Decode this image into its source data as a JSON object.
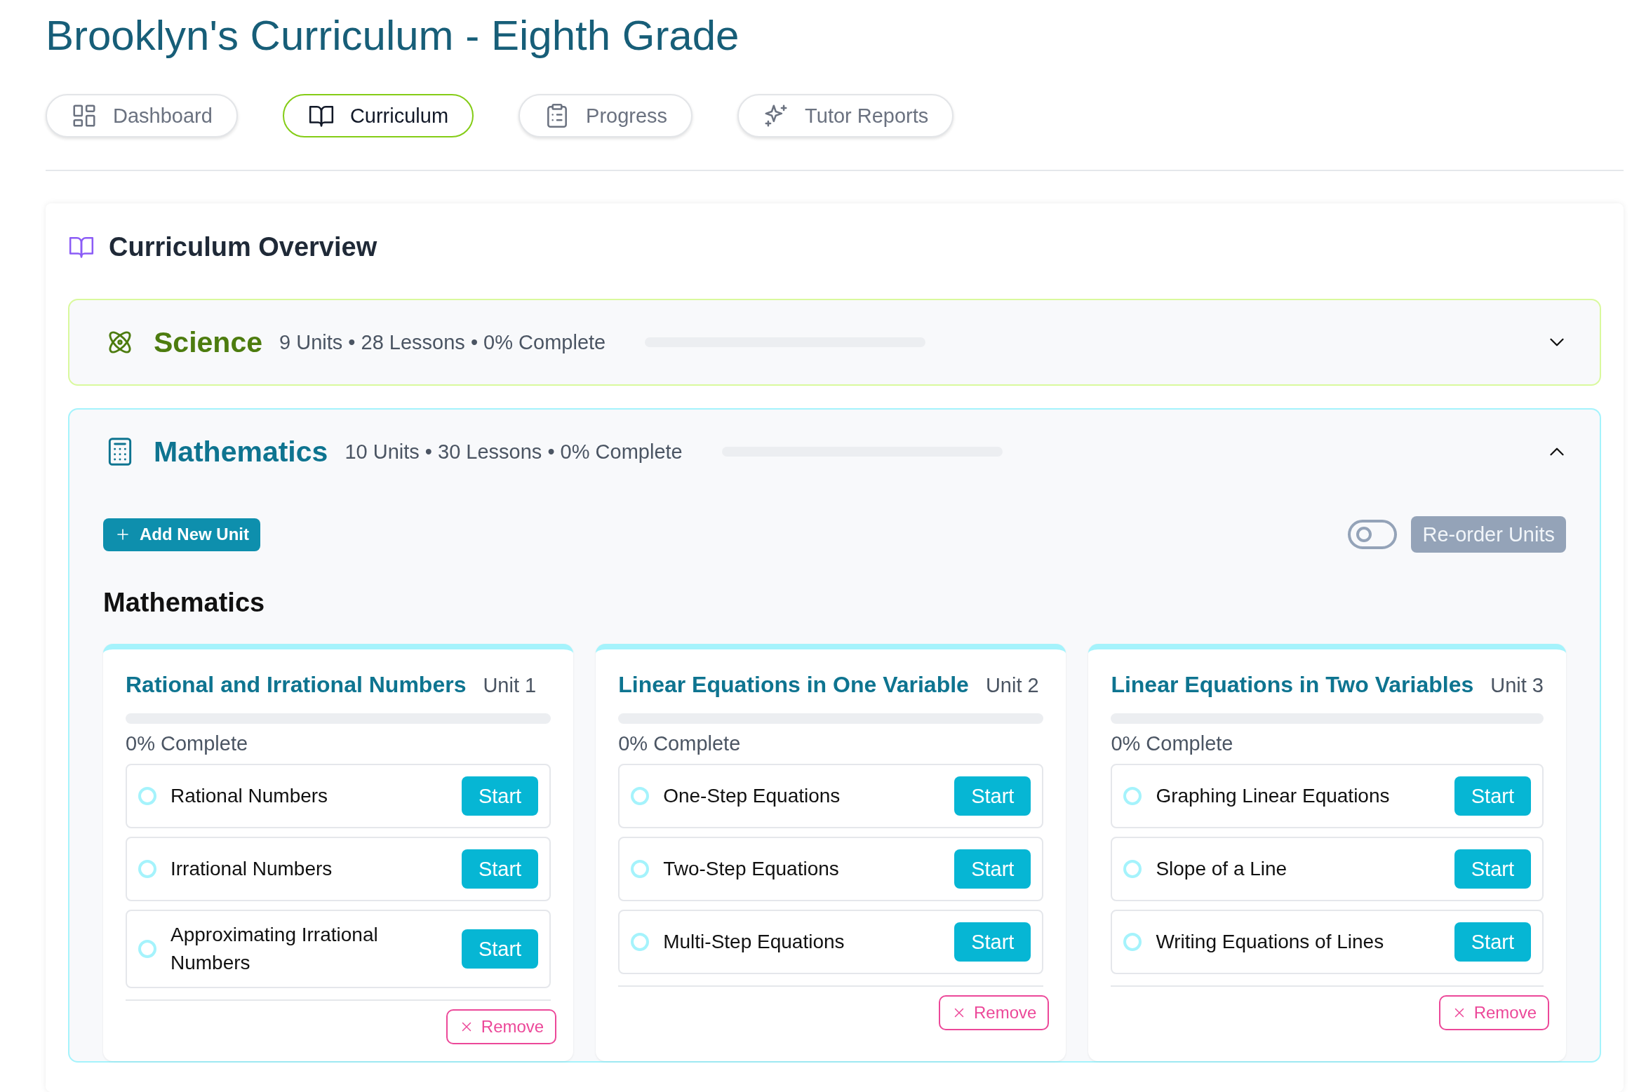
{
  "page_title": "Brooklyn's Curriculum - Eighth Grade",
  "tabs": [
    {
      "label": "Dashboard",
      "selected": false
    },
    {
      "label": "Curriculum",
      "selected": true
    },
    {
      "label": "Progress",
      "selected": false
    },
    {
      "label": "Tutor Reports",
      "selected": false
    }
  ],
  "overview": {
    "title": "Curriculum Overview"
  },
  "subjects": [
    {
      "name": "Science",
      "stats": "9 Units • 28 Lessons • 0% Complete",
      "level": 0,
      "expanded": false
    },
    {
      "name": "Mathematics",
      "stats": "10 Units • 30 Lessons • 0% Complete",
      "level": 0,
      "expanded": true,
      "add_button": "Add New Unit",
      "reorder_toggle": {
        "on": false
      },
      "reorder_button": "Re-order Units",
      "heading": "Mathematics",
      "units": [
        {
          "title": "Rational and Irrational Numbers",
          "unit": "Unit 1",
          "level": 0,
          "progress_text": "0% Complete",
          "remove": "Remove",
          "lessons": [
            {
              "name": "Rational Numbers",
              "completed": false,
              "action": "Start"
            },
            {
              "name": "Irrational Numbers",
              "completed": false,
              "action": "Start"
            },
            {
              "name": "Approximating Irrational Numbers",
              "completed": false,
              "action": "Start"
            }
          ]
        },
        {
          "title": "Linear Equations in One Variable",
          "unit": "Unit 2",
          "level": 0,
          "progress_text": "0% Complete",
          "remove": "Remove",
          "lessons": [
            {
              "name": "One-Step Equations",
              "completed": false,
              "action": "Start"
            },
            {
              "name": "Two-Step Equations",
              "completed": false,
              "action": "Start"
            },
            {
              "name": "Multi-Step Equations",
              "completed": false,
              "action": "Start"
            }
          ]
        },
        {
          "title": "Linear Equations in Two Variables",
          "unit": "Unit 3",
          "level": 0,
          "progress_text": "0% Complete",
          "remove": "Remove",
          "lessons": [
            {
              "name": "Graphing Linear Equations",
              "completed": false,
              "action": "Start"
            },
            {
              "name": "Slope of a Line",
              "completed": false,
              "action": "Start"
            },
            {
              "name": "Writing Equations of Lines",
              "completed": false,
              "action": "Start"
            }
          ]
        }
      ]
    }
  ]
}
